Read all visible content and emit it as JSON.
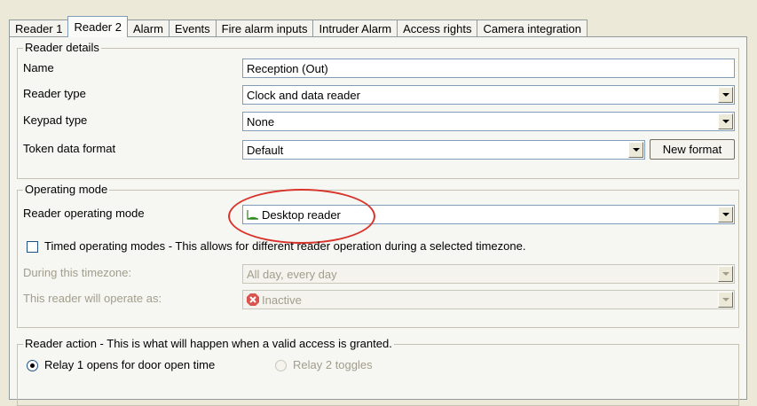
{
  "tabs": [
    "Reader 1",
    "Reader 2",
    "Alarm",
    "Events",
    "Fire alarm inputs",
    "Intruder Alarm",
    "Access rights",
    "Camera integration"
  ],
  "reader_details": {
    "legend": "Reader details",
    "name_label": "Name",
    "name_value": "Reception (Out)",
    "type_label": "Reader type",
    "type_value": "Clock and data reader",
    "keypad_label": "Keypad type",
    "keypad_value": "None",
    "token_label": "Token data format",
    "token_value": "Default",
    "new_format_button": "New format"
  },
  "operating_mode": {
    "legend": "Operating mode",
    "mode_label": "Reader operating mode",
    "mode_value": "Desktop reader",
    "mode_icon": "desktop-reader-icon",
    "timed_label": "Timed operating modes - This allows for different reader operation during a selected timezone.",
    "timezone_label": "During this timezone:",
    "timezone_value": "All day, every day",
    "operate_label": "This reader will operate as:",
    "operate_value": "Inactive",
    "operate_icon": "inactive-icon"
  },
  "reader_action": {
    "legend": "Reader action - This is what will happen when a valid access is granted.",
    "relay1_label": "Relay 1 opens for door open time",
    "relay2_label": "Relay 2 toggles"
  },
  "colors": {
    "highlight_circle": "#d8342c",
    "disabled_text": "#a19e8c"
  }
}
